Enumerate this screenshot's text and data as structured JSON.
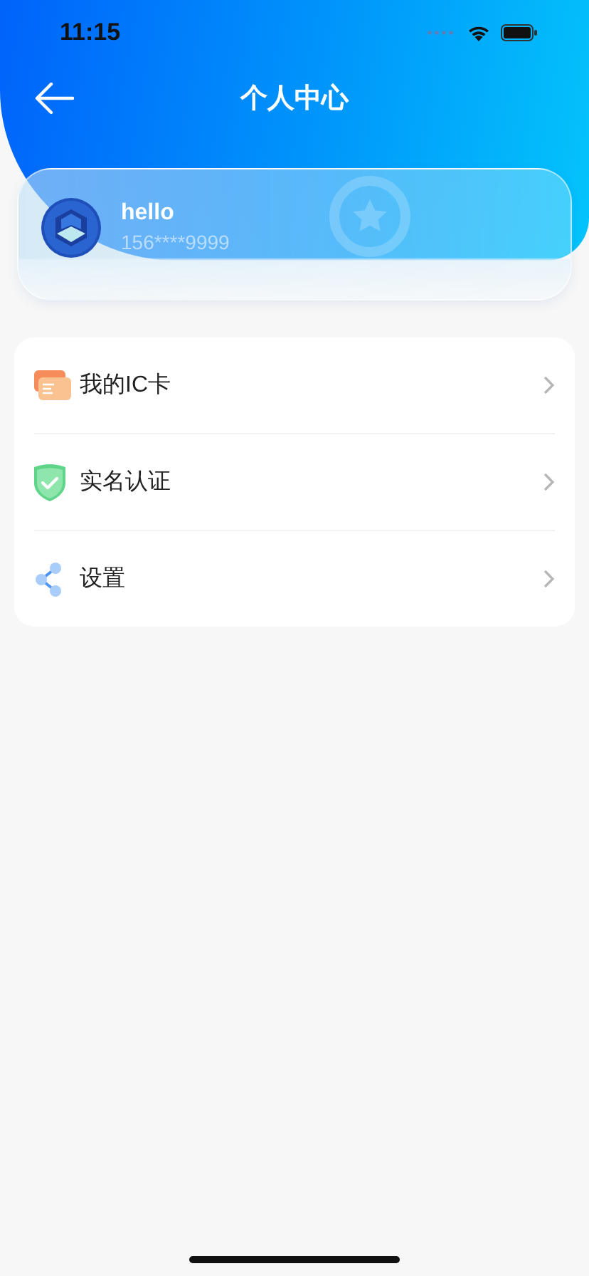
{
  "status_bar": {
    "time": "11:15"
  },
  "nav": {
    "title": "个人中心"
  },
  "profile": {
    "name": "hello",
    "phone": "156****9999"
  },
  "menu": [
    {
      "kind": "card",
      "label": "我的IC卡"
    },
    {
      "kind": "shield",
      "label": "实名认证"
    },
    {
      "kind": "share",
      "label": "设置"
    }
  ]
}
